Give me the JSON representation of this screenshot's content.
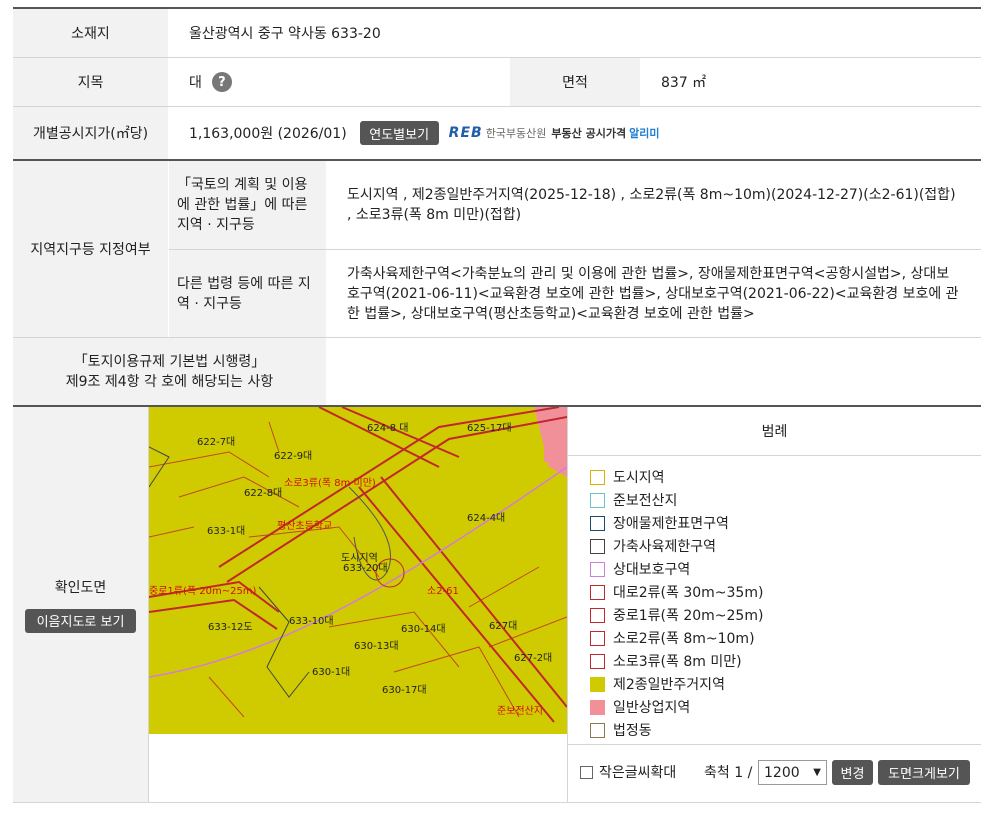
{
  "rows": {
    "location_label": "소재지",
    "location_value": "울산광역시 중구 약사동 633-20",
    "jimok_label": "지목",
    "jimok_value": "대",
    "help_glyph": "?",
    "area_label": "면적",
    "area_value": "837 ㎡",
    "price_label": "개별공시지가(㎡당)",
    "price_value": "1,163,000원 (2026/01)",
    "yearly_button": "연도별보기",
    "reb_logo": "REB",
    "reb_org": "한국부동산원",
    "reb_service": "부동산 공시가격",
    "reb_service_accent": "알리미"
  },
  "zoning": {
    "main_label": "지역지구등 지정여부",
    "national_label": "「국토의 계획 및 이용에 관한 법률」에 따른 지역 · 지구등",
    "national_value": "도시지역 , 제2종일반주거지역(2025-12-18) , 소로2류(폭 8m~10m)(2024-12-27)(소2-61)(접합) , 소로3류(폭 8m 미만)(접합)",
    "other_label": "다른 법령 등에 따른 지역 · 지구등",
    "other_value": "가축사육제한구역<가축분뇨의 관리 및 이용에 관한 법률>, 장애물제한표면구역<공항시설법>, 상대보호구역(2021-06-11)<교육환경 보호에 관한 법률>, 상대보호구역(2021-06-22)<교육환경 보호에 관한 법률>, 상대보호구역(평산초등학교)<교육환경 보호에 관한 법률>",
    "decree_label_1": "「토지이용규제 기본법 시행령」",
    "decree_label_2": "제9조 제4항 각 호에 해당되는 사항",
    "decree_value": ""
  },
  "map_section": {
    "label": "확인도면",
    "view_button": "이음지도로 보기",
    "legend_title": "범례",
    "legend": [
      {
        "name": "도시지역",
        "color": "#e0b000",
        "fill": "none"
      },
      {
        "name": "준보전산지",
        "color": "#6cc2d0",
        "fill": "none"
      },
      {
        "name": "장애물제한표면구역",
        "color": "#1b4a6b",
        "fill": "none"
      },
      {
        "name": "가축사육제한구역",
        "color": "#444444",
        "fill": "none"
      },
      {
        "name": "상대보호구역",
        "color": "#d27be0",
        "fill": "none"
      },
      {
        "name": "대로2류(폭 30m~35m)",
        "color": "#c0282d",
        "fill": "none"
      },
      {
        "name": "중로1류(폭 20m~25m)",
        "color": "#c0282d",
        "fill": "none"
      },
      {
        "name": "소로2류(폭 8m~10m)",
        "color": "#c0282d",
        "fill": "none"
      },
      {
        "name": "소로3류(폭 8m 미만)",
        "color": "#c0282d",
        "fill": "none"
      },
      {
        "name": "제2종일반주거지역",
        "color": "#cfcb00",
        "fill": "#cfcb00"
      },
      {
        "name": "일반상업지역",
        "color": "#f2909a",
        "fill": "#f2909a"
      },
      {
        "name": "법정동",
        "color": "#8a7a50",
        "fill": "none"
      }
    ],
    "small_text_label": "작은글씨확대",
    "scale_label": "축척 1 /",
    "scale_value": "1200",
    "change_button": "변경",
    "enlarge_button": "도면크게보기",
    "map_labels": {
      "parcel_1": "622-7대",
      "parcel_2": "622-9대",
      "parcel_3": "624-8 대",
      "parcel_4": "625-17대",
      "parcel_5": "622-8대",
      "parcel_6": "633-1대",
      "parcel_7": "624-4대",
      "parcel_8": "633-20대",
      "parcel_9": "633-12도",
      "parcel_10": "633-10대",
      "parcel_11": "630-13대",
      "parcel_12": "630-14대",
      "parcel_13": "627대",
      "parcel_14": "627-2대",
      "parcel_15": "630-1대",
      "parcel_16": "630-17대",
      "road_1": "소로3류(폭 8m 미만)",
      "road_2": "중로1류(폭 20m~25m)",
      "road_3": "소2-61",
      "school": "평산초등학교",
      "zone_1": "도시지역",
      "zone_2": "준보전산지"
    }
  }
}
